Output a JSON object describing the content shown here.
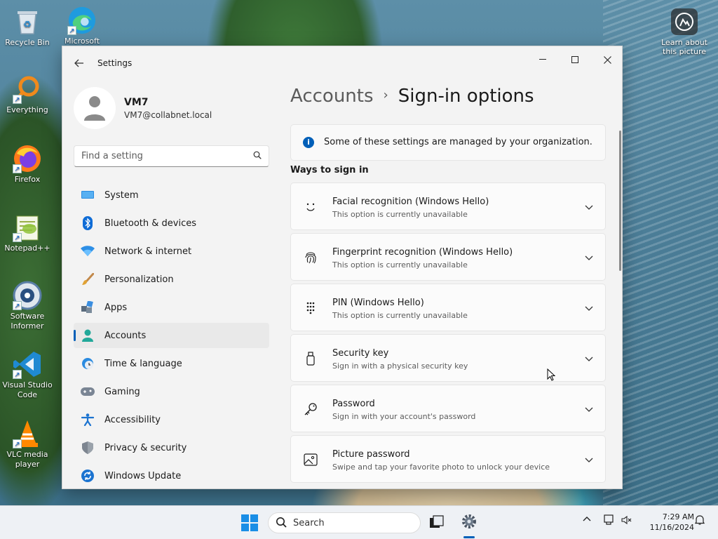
{
  "desktop": {
    "icons": [
      {
        "label": "Recycle Bin",
        "icon": "recycle-bin-icon"
      },
      {
        "label": "Microsoft",
        "icon": "edge-icon"
      },
      {
        "label": "Everything",
        "icon": "everything-icon"
      },
      {
        "label": "Firefox",
        "icon": "firefox-icon"
      },
      {
        "label": "Notepad++",
        "icon": "notepadpp-icon"
      },
      {
        "label": "Software Informer",
        "icon": "software-informer-icon"
      },
      {
        "label": "Visual Studio Code",
        "icon": "vscode-icon"
      },
      {
        "label": "VLC media player",
        "icon": "vlc-icon"
      }
    ],
    "learn_label": "Learn about this picture"
  },
  "window": {
    "title": "Settings",
    "minimize": "—",
    "maximize": "☐",
    "close": "✕"
  },
  "profile": {
    "name": "VM7",
    "email": "VM7@collabnet.local"
  },
  "search": {
    "placeholder": "Find a setting"
  },
  "nav": {
    "items": [
      {
        "label": "System",
        "icon": "system-icon"
      },
      {
        "label": "Bluetooth & devices",
        "icon": "bluetooth-icon"
      },
      {
        "label": "Network & internet",
        "icon": "wifi-icon"
      },
      {
        "label": "Personalization",
        "icon": "brush-icon"
      },
      {
        "label": "Apps",
        "icon": "apps-icon"
      },
      {
        "label": "Accounts",
        "icon": "accounts-icon"
      },
      {
        "label": "Time & language",
        "icon": "clock-globe-icon"
      },
      {
        "label": "Gaming",
        "icon": "gamepad-icon"
      },
      {
        "label": "Accessibility",
        "icon": "accessibility-icon"
      },
      {
        "label": "Privacy & security",
        "icon": "shield-icon"
      },
      {
        "label": "Windows Update",
        "icon": "update-icon"
      }
    ],
    "active": "Accounts"
  },
  "breadcrumb": {
    "parent": "Accounts",
    "separator": "›",
    "current": "Sign-in options"
  },
  "notice": {
    "text": "Some of these settings are managed by your organization."
  },
  "section": {
    "title": "Ways to sign in"
  },
  "signin_options": [
    {
      "title": "Facial recognition (Windows Hello)",
      "subtitle": "This option is currently unavailable",
      "icon": "face-icon"
    },
    {
      "title": "Fingerprint recognition (Windows Hello)",
      "subtitle": "This option is currently unavailable",
      "icon": "fingerprint-icon"
    },
    {
      "title": "PIN (Windows Hello)",
      "subtitle": "This option is currently unavailable",
      "icon": "keypad-icon"
    },
    {
      "title": "Security key",
      "subtitle": "Sign in with a physical security key",
      "icon": "usb-key-icon"
    },
    {
      "title": "Password",
      "subtitle": "Sign in with your account's password",
      "icon": "key-icon"
    },
    {
      "title": "Picture password",
      "subtitle": "Swipe and tap your favorite photo to unlock your device",
      "icon": "picture-icon"
    }
  ],
  "taskbar": {
    "search_label": "Search",
    "time": "7:29 AM",
    "date": "11/16/2024"
  },
  "colors": {
    "accent": "#005fb8"
  }
}
